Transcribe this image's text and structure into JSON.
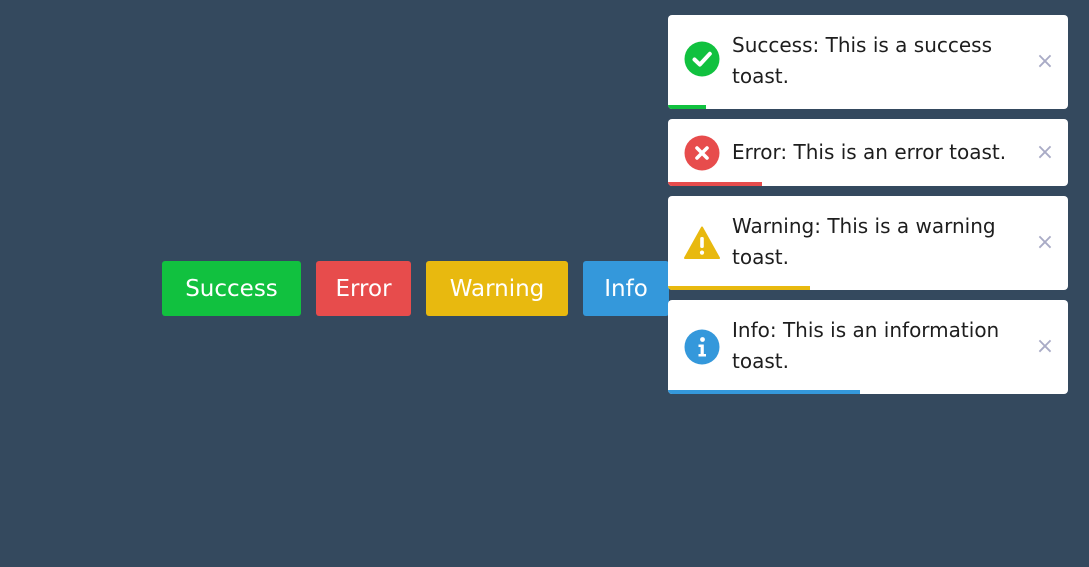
{
  "buttons": {
    "success": {
      "label": "Success",
      "color": "#11c13f"
    },
    "error": {
      "label": "Error",
      "color": "#e74c4c"
    },
    "warning": {
      "label": "Warning",
      "color": "#e8b90f"
    },
    "info": {
      "label": "Info",
      "color": "#3498db"
    }
  },
  "toasts": [
    {
      "type": "success",
      "message": "Success: This is a success toast.",
      "icon": "check-circle-icon",
      "color": "#11c13f",
      "progress": 0.095,
      "close": "×"
    },
    {
      "type": "error",
      "message": "Error: This is an error toast.",
      "icon": "x-circle-icon",
      "color": "#e74c4c",
      "progress": 0.235,
      "close": "×"
    },
    {
      "type": "warning",
      "message": "Warning: This is a warning toast.",
      "icon": "warning-triangle-icon",
      "color": "#e8b90f",
      "progress": 0.355,
      "close": "×"
    },
    {
      "type": "info",
      "message": "Info: This is an information toast.",
      "icon": "info-circle-icon",
      "color": "#3498db",
      "progress": 0.48,
      "close": "×"
    }
  ]
}
